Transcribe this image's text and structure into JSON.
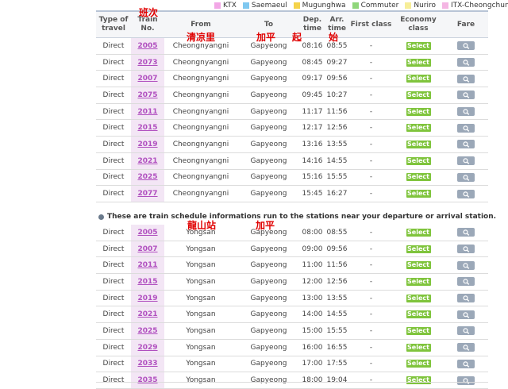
{
  "legend": [
    {
      "label": "KTX",
      "color": "#f2a7e6"
    },
    {
      "label": "Saemaeul",
      "color": "#7fc8f0"
    },
    {
      "label": "Mugunghwa",
      "color": "#f5d34a"
    },
    {
      "label": "Commuter",
      "color": "#8fd67a"
    },
    {
      "label": "Nuriro",
      "color": "#f7ee99"
    },
    {
      "label": "ITX-Cheongchun",
      "color": "#f4b6e3"
    }
  ],
  "headers": {
    "type_of_travel": "Type of travel",
    "train_no": "Train No.",
    "from": "From",
    "to": "To",
    "dep_time": "Dep. time",
    "arr_time": "Arr. time",
    "first_class": "First class",
    "economy_class": "Economy class",
    "fare": "Fare"
  },
  "select_label": "Select",
  "annotations": {
    "train_no": "班次",
    "from_cheongnyangni": "清凉里",
    "to_gapyeong": "加平",
    "dep": "起",
    "arr": "始",
    "from_yongsan": "龍山站",
    "to_gapyeong_2": "加平"
  },
  "note": "These are train schedule informations run to the stations near your departure or arrival station.",
  "table1_rows": [
    {
      "type": "Direct",
      "no": "2005",
      "from": "Cheongnyangni",
      "to": "Gapyeong",
      "dep": "08:16",
      "arr": "08:55",
      "first": "-"
    },
    {
      "type": "Direct",
      "no": "2073",
      "from": "Cheongnyangni",
      "to": "Gapyeong",
      "dep": "08:45",
      "arr": "09:27",
      "first": "-"
    },
    {
      "type": "Direct",
      "no": "2007",
      "from": "Cheongnyangni",
      "to": "Gapyeong",
      "dep": "09:17",
      "arr": "09:56",
      "first": "-"
    },
    {
      "type": "Direct",
      "no": "2075",
      "from": "Cheongnyangni",
      "to": "Gapyeong",
      "dep": "09:45",
      "arr": "10:27",
      "first": "-"
    },
    {
      "type": "Direct",
      "no": "2011",
      "from": "Cheongnyangni",
      "to": "Gapyeong",
      "dep": "11:17",
      "arr": "11:56",
      "first": "-"
    },
    {
      "type": "Direct",
      "no": "2015",
      "from": "Cheongnyangni",
      "to": "Gapyeong",
      "dep": "12:17",
      "arr": "12:56",
      "first": "-"
    },
    {
      "type": "Direct",
      "no": "2019",
      "from": "Cheongnyangni",
      "to": "Gapyeong",
      "dep": "13:16",
      "arr": "13:55",
      "first": "-"
    },
    {
      "type": "Direct",
      "no": "2021",
      "from": "Cheongnyangni",
      "to": "Gapyeong",
      "dep": "14:16",
      "arr": "14:55",
      "first": "-"
    },
    {
      "type": "Direct",
      "no": "2025",
      "from": "Cheongnyangni",
      "to": "Gapyeong",
      "dep": "15:16",
      "arr": "15:55",
      "first": "-"
    },
    {
      "type": "Direct",
      "no": "2077",
      "from": "Cheongnyangni",
      "to": "Gapyeong",
      "dep": "15:45",
      "arr": "16:27",
      "first": "-"
    }
  ],
  "table2_rows": [
    {
      "type": "Direct",
      "no": "2005",
      "from": "Yongsan",
      "to": "Gapyeong",
      "dep": "08:00",
      "arr": "08:55",
      "first": "-"
    },
    {
      "type": "Direct",
      "no": "2007",
      "from": "Yongsan",
      "to": "Gapyeong",
      "dep": "09:00",
      "arr": "09:56",
      "first": "-"
    },
    {
      "type": "Direct",
      "no": "2011",
      "from": "Yongsan",
      "to": "Gapyeong",
      "dep": "11:00",
      "arr": "11:56",
      "first": "-"
    },
    {
      "type": "Direct",
      "no": "2015",
      "from": "Yongsan",
      "to": "Gapyeong",
      "dep": "12:00",
      "arr": "12:56",
      "first": "-"
    },
    {
      "type": "Direct",
      "no": "2019",
      "from": "Yongsan",
      "to": "Gapyeong",
      "dep": "13:00",
      "arr": "13:55",
      "first": "-"
    },
    {
      "type": "Direct",
      "no": "2021",
      "from": "Yongsan",
      "to": "Gapyeong",
      "dep": "14:00",
      "arr": "14:55",
      "first": "-"
    },
    {
      "type": "Direct",
      "no": "2025",
      "from": "Yongsan",
      "to": "Gapyeong",
      "dep": "15:00",
      "arr": "15:55",
      "first": "-"
    },
    {
      "type": "Direct",
      "no": "2029",
      "from": "Yongsan",
      "to": "Gapyeong",
      "dep": "16:00",
      "arr": "16:55",
      "first": "-"
    },
    {
      "type": "Direct",
      "no": "2033",
      "from": "Yongsan",
      "to": "Gapyeong",
      "dep": "17:00",
      "arr": "17:55",
      "first": "-"
    },
    {
      "type": "Direct",
      "no": "2035",
      "from": "Yongsan",
      "to": "Gapyeong",
      "dep": "18:00",
      "arr": "19:04",
      "first": "-"
    }
  ]
}
